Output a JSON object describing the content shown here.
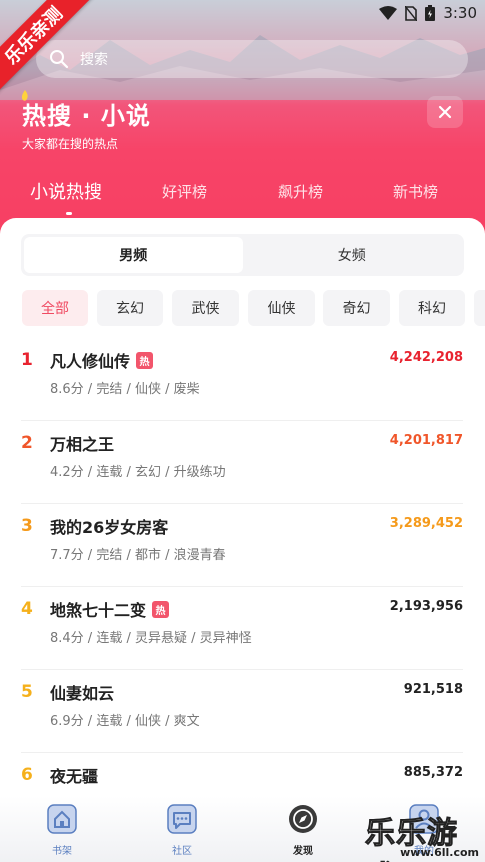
{
  "status_bar": {
    "time": "3:30"
  },
  "watermark_ribbon": "乐乐亲测",
  "search": {
    "placeholder": "搜索"
  },
  "header": {
    "title": "热搜 · 小说",
    "subtitle": "大家都在搜的热点"
  },
  "tabs": [
    {
      "label": "小说热搜",
      "active": true
    },
    {
      "label": "好评榜",
      "active": false
    },
    {
      "label": "飙升榜",
      "active": false
    },
    {
      "label": "新书榜",
      "active": false
    }
  ],
  "gender_toggle": [
    {
      "label": "男频",
      "active": true
    },
    {
      "label": "女频",
      "active": false
    }
  ],
  "categories": [
    {
      "label": "全部",
      "active": true
    },
    {
      "label": "玄幻",
      "active": false
    },
    {
      "label": "武侠",
      "active": false
    },
    {
      "label": "仙侠",
      "active": false
    },
    {
      "label": "奇幻",
      "active": false
    },
    {
      "label": "科幻",
      "active": false
    }
  ],
  "rankings": [
    {
      "rank": "1",
      "title": "凡人修仙传",
      "hot": true,
      "meta": "8.6分 / 完结 / 仙侠 / 废柴",
      "count": "4,242,208",
      "color": "#e8232f"
    },
    {
      "rank": "2",
      "title": "万相之王",
      "hot": false,
      "meta": "4.2分 / 连载 / 玄幻 / 升级练功",
      "count": "4,201,817",
      "color": "#f0562a"
    },
    {
      "rank": "3",
      "title": "我的26岁女房客",
      "hot": false,
      "meta": "7.7分 / 完结 / 都市 / 浪漫青春",
      "count": "3,289,452",
      "color": "#f59a1b"
    },
    {
      "rank": "4",
      "title": "地煞七十二变",
      "hot": true,
      "meta": "8.4分 / 连载 / 灵异悬疑 / 灵异神怪",
      "count": "2,193,956",
      "color": "#222222"
    },
    {
      "rank": "5",
      "title": "仙妻如云",
      "hot": false,
      "meta": "6.9分 / 连载 / 仙侠 / 爽文",
      "count": "921,518",
      "color": "#222222"
    },
    {
      "rank": "6",
      "title": "夜无疆",
      "hot": false,
      "meta": "",
      "count": "885,372",
      "color": "#222222"
    }
  ],
  "hot_badge": "热",
  "bottom_nav": [
    {
      "label": "书架",
      "icon": "bookshelf-icon",
      "active": false
    },
    {
      "label": "社区",
      "icon": "community-icon",
      "active": false
    },
    {
      "label": "发现",
      "icon": "compass-icon",
      "active": true
    },
    {
      "label": "我的",
      "icon": "profile-icon",
      "active": false
    }
  ],
  "watermark": {
    "title": "乐乐游戏",
    "url": "www.6ll.com"
  },
  "colors": {
    "accent": "#f74468",
    "rank1": "#e8232f",
    "rank2": "#f0562a",
    "rank3": "#f59a1b",
    "nav_blue": "#5b7fc0"
  }
}
